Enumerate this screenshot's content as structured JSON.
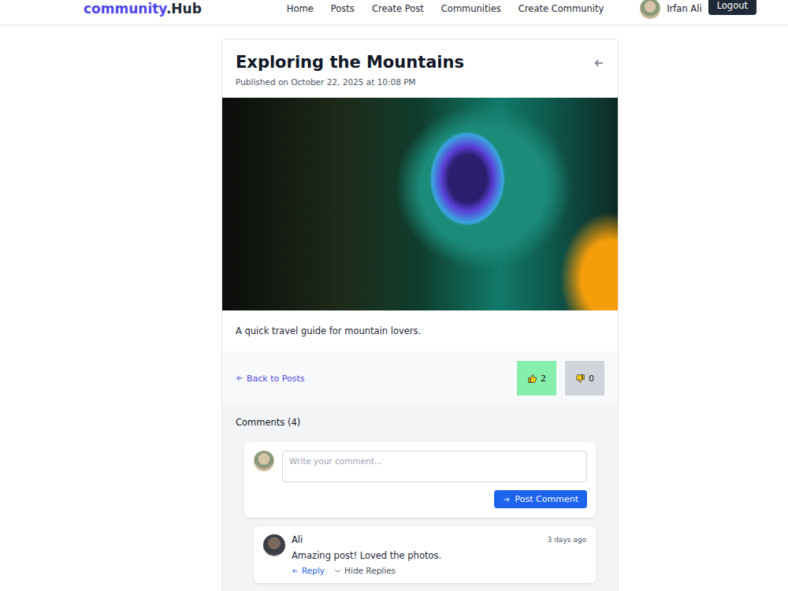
{
  "nav": {
    "logo_main": "community",
    "logo_suffix": ".Hub",
    "links": [
      "Home",
      "Posts",
      "Create Post",
      "Communities",
      "Create Community"
    ],
    "user": "Irfan Ali",
    "logout": "Logout"
  },
  "post": {
    "title": "Exploring the Mountains",
    "published": "Published on October 22, 2025 at 10:08 PM",
    "description": "A quick travel guide for mountain lovers.",
    "back": "Back to Posts",
    "likes": "2",
    "dislikes": "0",
    "liked": true,
    "disliked": false
  },
  "comments": {
    "heading": "Comments (4)",
    "placeholder": "Write your comment...",
    "submit": "Post Comment",
    "items": [
      {
        "author": "Ali",
        "time": "3 days ago",
        "text": "Amazing post! Loved the photos.",
        "reply": "Reply",
        "toggle": "Hide Replies",
        "expanded": true
      }
    ]
  }
}
